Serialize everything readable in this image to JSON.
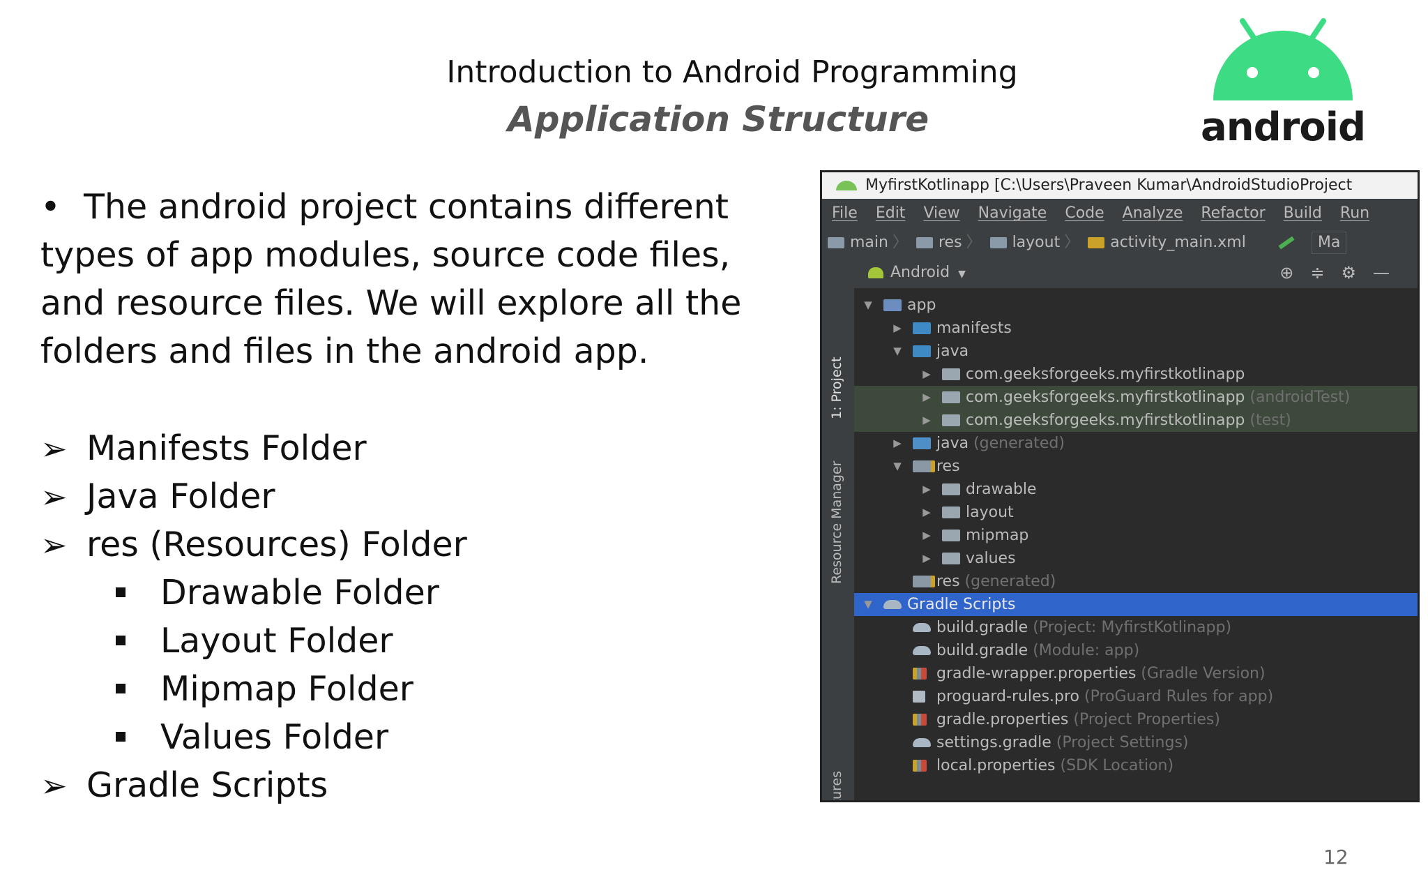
{
  "slide": {
    "title": "Introduction to Android Programming",
    "subtitle": "Application Structure",
    "logo_text": "android",
    "page_number": "12"
  },
  "bullets": {
    "intro": "The android project contains different types of app modules, source code files, and resource files. We will explore all the folders and files in the android app.",
    "items": [
      {
        "text": "Manifests Folder",
        "level": 1
      },
      {
        "text": "Java Folder",
        "level": 1
      },
      {
        "text": "res (Resources) Folder",
        "level": 1
      },
      {
        "text": "Drawable Folder",
        "level": 2
      },
      {
        "text": "Layout Folder",
        "level": 2
      },
      {
        "text": "Mipmap Folder",
        "level": 2
      },
      {
        "text": "Values Folder",
        "level": 2
      },
      {
        "text": "Gradle Scripts",
        "level": 1
      }
    ]
  },
  "ide": {
    "window_title": "MyfirstKotlinapp [C:\\Users\\Praveen Kumar\\AndroidStudioProject",
    "menu": [
      "File",
      "Edit",
      "View",
      "Navigate",
      "Code",
      "Analyze",
      "Refactor",
      "Build",
      "Run"
    ],
    "breadcrumbs": [
      "main",
      "res",
      "layout",
      "activity_main.xml"
    ],
    "run_config": "Ma",
    "side_tabs": [
      "1: Project",
      "Resource Manager",
      "Layout Captures"
    ],
    "view_mode": "Android",
    "tree": [
      {
        "label": "app",
        "extra": "",
        "level": 0,
        "arrow": "▼",
        "icon": "app",
        "state": ""
      },
      {
        "label": "manifests",
        "extra": "",
        "level": 1,
        "arrow": "▶",
        "icon": "folder-blue",
        "state": ""
      },
      {
        "label": "java",
        "extra": "",
        "level": 1,
        "arrow": "▼",
        "icon": "folder-blue",
        "state": ""
      },
      {
        "label": "com.geeksforgeeks.myfirstkotlinapp",
        "extra": "",
        "level": 2,
        "arrow": "▶",
        "icon": "folder-grey",
        "state": ""
      },
      {
        "label": "com.geeksforgeeks.myfirstkotlinapp",
        "extra": "(androidTest)",
        "level": 2,
        "arrow": "▶",
        "icon": "folder-grey",
        "state": "hl"
      },
      {
        "label": "com.geeksforgeeks.myfirstkotlinapp",
        "extra": "(test)",
        "level": 2,
        "arrow": "▶",
        "icon": "folder-grey",
        "state": "hl"
      },
      {
        "label": "java",
        "extra": "(generated)",
        "level": 1,
        "arrow": "▶",
        "icon": "jgen",
        "state": ""
      },
      {
        "label": "res",
        "extra": "",
        "level": 1,
        "arrow": "▼",
        "icon": "folder-res",
        "state": ""
      },
      {
        "label": "drawable",
        "extra": "",
        "level": 2,
        "arrow": "▶",
        "icon": "folder-grey",
        "state": ""
      },
      {
        "label": "layout",
        "extra": "",
        "level": 2,
        "arrow": "▶",
        "icon": "folder-grey",
        "state": ""
      },
      {
        "label": "mipmap",
        "extra": "",
        "level": 2,
        "arrow": "▶",
        "icon": "folder-grey",
        "state": ""
      },
      {
        "label": "values",
        "extra": "",
        "level": 2,
        "arrow": "▶",
        "icon": "folder-grey",
        "state": ""
      },
      {
        "label": "res",
        "extra": "(generated)",
        "level": 1,
        "arrow": "",
        "icon": "folder-res",
        "state": ""
      },
      {
        "label": "Gradle Scripts",
        "extra": "",
        "level": 0,
        "arrow": "▼",
        "icon": "gradle",
        "state": "sel"
      },
      {
        "label": "build.gradle",
        "extra": "(Project: MyfirstKotlinapp)",
        "level": 1,
        "arrow": "",
        "icon": "gradle",
        "state": ""
      },
      {
        "label": "build.gradle",
        "extra": "(Module: app)",
        "level": 1,
        "arrow": "",
        "icon": "gradle",
        "state": ""
      },
      {
        "label": "gradle-wrapper.properties",
        "extra": "(Gradle Version)",
        "level": 1,
        "arrow": "",
        "icon": "props",
        "state": ""
      },
      {
        "label": "proguard-rules.pro",
        "extra": "(ProGuard Rules for app)",
        "level": 1,
        "arrow": "",
        "icon": "pro",
        "state": ""
      },
      {
        "label": "gradle.properties",
        "extra": "(Project Properties)",
        "level": 1,
        "arrow": "",
        "icon": "props",
        "state": ""
      },
      {
        "label": "settings.gradle",
        "extra": "(Project Settings)",
        "level": 1,
        "arrow": "",
        "icon": "gradle",
        "state": ""
      },
      {
        "label": "local.properties",
        "extra": "(SDK Location)",
        "level": 1,
        "arrow": "",
        "icon": "props",
        "state": ""
      }
    ]
  },
  "colors": {
    "android_green": "#3ddc84",
    "selection": "#2f65ca",
    "tree_bg": "#2b2b2b"
  }
}
